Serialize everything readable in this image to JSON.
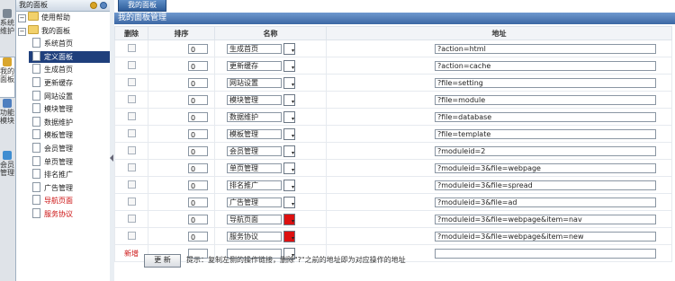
{
  "vertical_tabs": [
    {
      "label": "系统维护",
      "icon": "wrench-icon",
      "active": false
    },
    {
      "label": "我的面板",
      "icon": "panel-icon",
      "active": true
    },
    {
      "label": "功能模块",
      "icon": "module-icon",
      "active": false
    },
    {
      "label": "会员管理",
      "icon": "user-icon",
      "active": false
    }
  ],
  "sidebar": {
    "title": "我的面板",
    "items": [
      {
        "label": "使用帮助",
        "type": "folder"
      },
      {
        "label": "我的面板",
        "type": "folder"
      },
      {
        "label": "系统首页",
        "type": "doc"
      },
      {
        "label": "定义面板",
        "type": "doc",
        "selected": true
      },
      {
        "label": "生成首页",
        "type": "doc"
      },
      {
        "label": "更新缓存",
        "type": "doc"
      },
      {
        "label": "网站设置",
        "type": "doc"
      },
      {
        "label": "模块管理",
        "type": "doc"
      },
      {
        "label": "数据维护",
        "type": "doc"
      },
      {
        "label": "模板管理",
        "type": "doc"
      },
      {
        "label": "会员管理",
        "type": "doc"
      },
      {
        "label": "单页管理",
        "type": "doc"
      },
      {
        "label": "排名推广",
        "type": "doc"
      },
      {
        "label": "广告管理",
        "type": "doc"
      },
      {
        "label": "导航页面",
        "type": "doc",
        "red": true
      },
      {
        "label": "服务协议",
        "type": "doc",
        "red": true
      }
    ]
  },
  "main": {
    "tab": "我的面板",
    "panel_title": "我的面板管理",
    "columns": {
      "delete": "删除",
      "order": "排序",
      "name": "名称",
      "address": "地址"
    },
    "rows": [
      {
        "order": "0",
        "name": "生成首页",
        "color": "#ffffff",
        "address": "?action=html"
      },
      {
        "order": "0",
        "name": "更新缓存",
        "color": "#ffffff",
        "address": "?action=cache"
      },
      {
        "order": "0",
        "name": "网站设置",
        "color": "#ffffff",
        "address": "?file=setting"
      },
      {
        "order": "0",
        "name": "模块管理",
        "color": "#ffffff",
        "address": "?file=module"
      },
      {
        "order": "0",
        "name": "数据维护",
        "color": "#ffffff",
        "address": "?file=database"
      },
      {
        "order": "0",
        "name": "模板管理",
        "color": "#ffffff",
        "address": "?file=template"
      },
      {
        "order": "0",
        "name": "会员管理",
        "color": "#ffffff",
        "address": "?moduleid=2"
      },
      {
        "order": "0",
        "name": "单页管理",
        "color": "#ffffff",
        "address": "?moduleid=3&file=webpage"
      },
      {
        "order": "0",
        "name": "排名推广",
        "color": "#ffffff",
        "address": "?moduleid=3&file=spread"
      },
      {
        "order": "0",
        "name": "广告管理",
        "color": "#ffffff",
        "address": "?moduleid=3&file=ad"
      },
      {
        "order": "0",
        "name": "导航页面",
        "color": "#dd1111",
        "address": "?moduleid=3&file=webpage&item=nav"
      },
      {
        "order": "0",
        "name": "服务协议",
        "color": "#dd1111",
        "address": "?moduleid=3&file=webpage&item=new"
      }
    ],
    "add_label": "新增",
    "update_button": "更 新",
    "tip": "提示：复制左侧的操作链接，删除\"?\"之前的地址即为对应操作的地址"
  }
}
